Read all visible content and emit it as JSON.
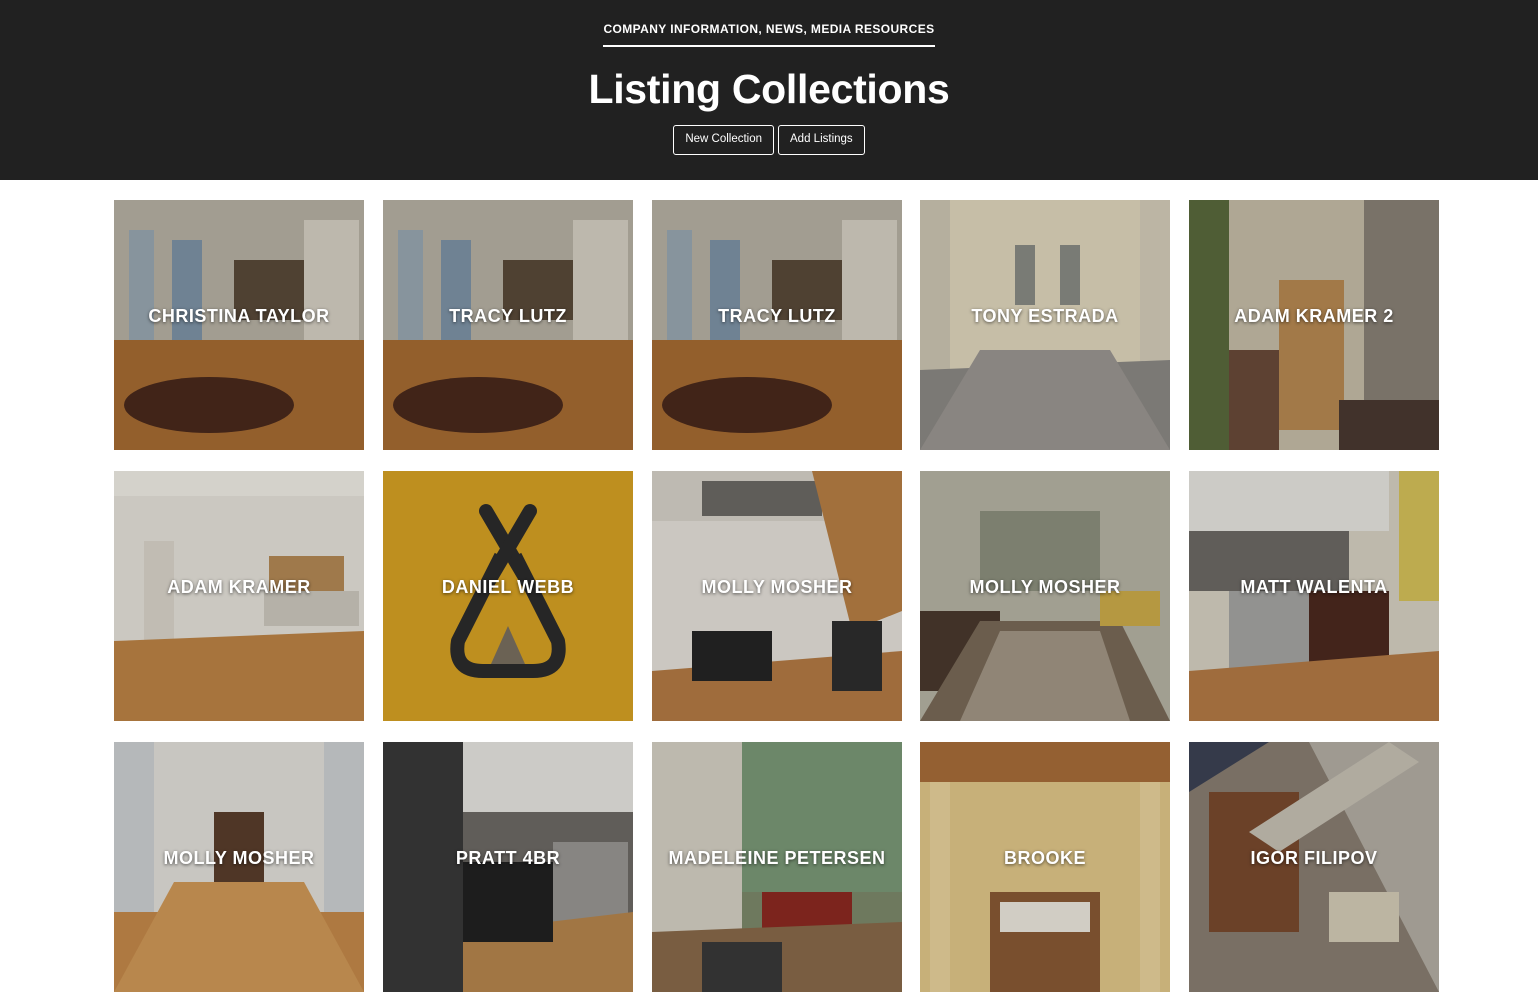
{
  "header": {
    "top_link": "COMPANY INFORMATION, NEWS, MEDIA RESOURCES",
    "title": "Listing Collections",
    "new_collection_label": "New Collection",
    "add_listings_label": "Add Listings",
    "background_color": "#212121"
  },
  "collections": [
    {
      "name": "CHRISTINA TAYLOR",
      "image": "apartment-photo"
    },
    {
      "name": "TRACY LUTZ",
      "image": "apartment-photo"
    },
    {
      "name": "TRACY LUTZ",
      "image": "apartment-photo"
    },
    {
      "name": "TONY ESTRADA",
      "image": "apartment-photo"
    },
    {
      "name": "ADAM KRAMER 2",
      "image": "apartment-photo"
    },
    {
      "name": "ADAM KRAMER",
      "image": "apartment-photo"
    },
    {
      "name": "DANIEL WEBB",
      "image": "teepee-logo",
      "color": "#BE8F1F"
    },
    {
      "name": "MOLLY MOSHER",
      "image": "apartment-photo"
    },
    {
      "name": "MOLLY MOSHER",
      "image": "apartment-photo"
    },
    {
      "name": "MATT WALENTA",
      "image": "apartment-photo"
    },
    {
      "name": "MOLLY MOSHER",
      "image": "apartment-photo"
    },
    {
      "name": "PRATT 4BR",
      "image": "apartment-photo"
    },
    {
      "name": "MADELEINE PETERSEN",
      "image": "apartment-photo"
    },
    {
      "name": "BROOKE",
      "image": "apartment-photo"
    },
    {
      "name": "IGOR FILIPOV",
      "image": "apartment-photo"
    }
  ]
}
